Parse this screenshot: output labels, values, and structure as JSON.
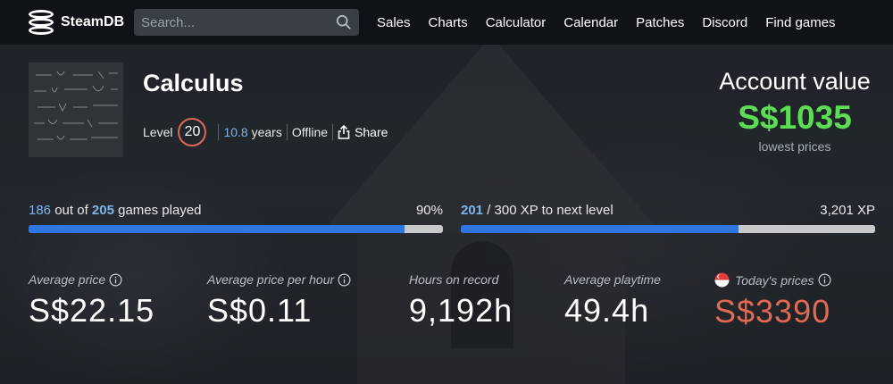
{
  "nav": {
    "logo_text": "SteamDB",
    "search_placeholder": "Search...",
    "links": [
      "Sales",
      "Charts",
      "Calculator",
      "Calendar",
      "Patches",
      "Discord",
      "Find games"
    ]
  },
  "profile": {
    "name": "Calculus",
    "level_label": "Level",
    "level": "20",
    "years_value": "10.8",
    "years_label": "years",
    "status": "Offline",
    "share_label": "Share"
  },
  "account": {
    "title": "Account value",
    "value": "S$1035",
    "note": "lowest prices"
  },
  "games_progress": {
    "played": "186",
    "out_of": "out of",
    "total": "205",
    "suffix": "games played",
    "percent_label": "90%",
    "fraction": 0.907
  },
  "xp_progress": {
    "current": "201",
    "rest": "/ 300 XP to next level",
    "total_xp": "3,201 XP",
    "fraction": 0.67
  },
  "stats": [
    {
      "label": "Average price",
      "value": "S$22.15",
      "info": true
    },
    {
      "label": "Average price per hour",
      "value": "S$0.11",
      "info": true
    },
    {
      "label": "Hours on record",
      "value": "9,192h",
      "info": false
    },
    {
      "label": "Average playtime",
      "value": "49.4h",
      "info": false
    },
    {
      "label": "Today's prices",
      "value": "S$3390",
      "info": true,
      "flag": "singapore-flag"
    }
  ],
  "colors": {
    "accent_blue": "#2f76e0",
    "value_green": "#5fdc55",
    "today_red": "#e36a52",
    "level_ring": "#e0685a"
  }
}
